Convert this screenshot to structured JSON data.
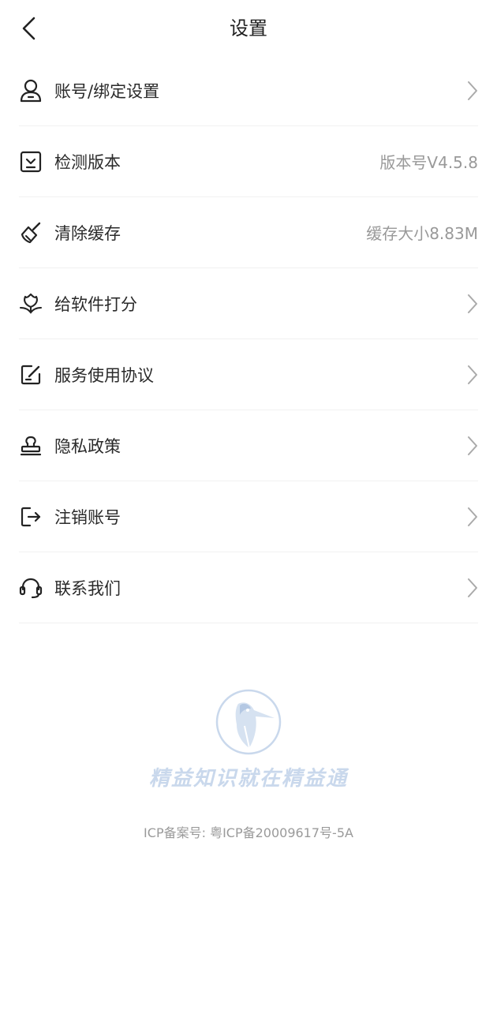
{
  "header": {
    "title": "设置",
    "back_icon": "chevron-left-icon"
  },
  "menu": {
    "items": [
      {
        "label": "账号/绑定设置",
        "icon": "user-icon",
        "value": "",
        "arrow": true
      },
      {
        "label": "检测版本",
        "icon": "download-box-icon",
        "value": "版本号V4.5.8",
        "arrow": false
      },
      {
        "label": "清除缓存",
        "icon": "broom-icon",
        "value": "缓存大小8.83M",
        "arrow": false
      },
      {
        "label": "给软件打分",
        "icon": "flower-icon",
        "value": "",
        "arrow": true
      },
      {
        "label": "服务使用协议",
        "icon": "edit-icon",
        "value": "",
        "arrow": true
      },
      {
        "label": "隐私政策",
        "icon": "stamp-icon",
        "value": "",
        "arrow": true
      },
      {
        "label": "注销账号",
        "icon": "logout-icon",
        "value": "",
        "arrow": true
      },
      {
        "label": "联系我们",
        "icon": "headset-icon",
        "value": "",
        "arrow": true
      }
    ]
  },
  "brand": {
    "logo_icon": "woodpecker-logo-icon",
    "slogan": "精益知识就在精益通"
  },
  "footer": {
    "icp": "ICP备案号: 粤ICP备20009617号-5A"
  },
  "colors": {
    "text": "#2a2a2a",
    "secondary": "#999999",
    "divider": "#f1f1f1",
    "brand_light": "#c9d8ec"
  }
}
